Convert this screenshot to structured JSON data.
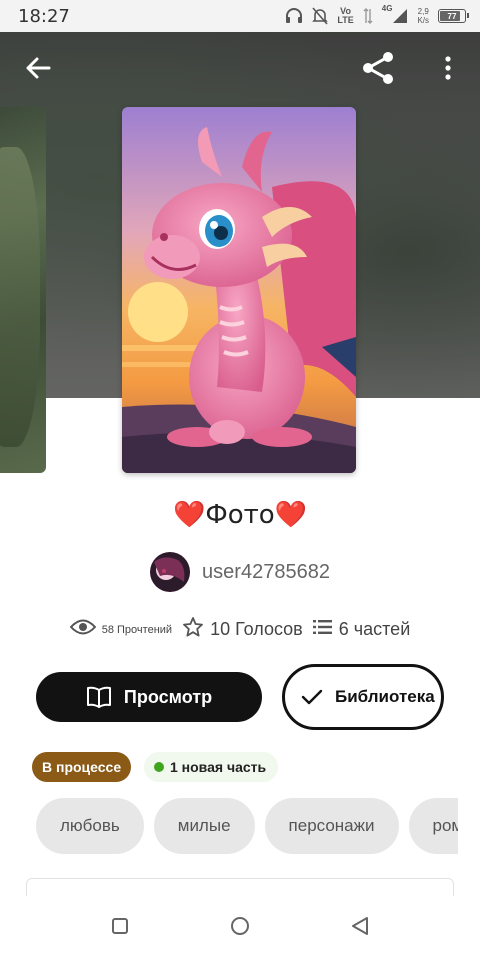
{
  "status_bar": {
    "time": "18:27",
    "signal_label_top": "Vo",
    "signal_label_bottom": "LTE",
    "network_label": "4G",
    "speed_value": "2,9",
    "speed_unit": "K/s",
    "battery_level": "77"
  },
  "header": {
    "back_icon": "arrow-left-icon",
    "share_icon": "share-icon",
    "more_icon": "more-vertical-icon"
  },
  "story": {
    "title_heart_left": "❤️",
    "title_text": "Фото",
    "title_heart_right": "❤️",
    "author_name": "user42785682",
    "reads_label": "58 Прочтений",
    "votes_label": "10 Голосов",
    "parts_label": "6 частей",
    "read_button_label": "Просмотр",
    "library_button_label": "Библиотека",
    "status_chip": "В процессе",
    "new_part_chip": "1 новая часть",
    "tags": [
      "любовь",
      "милые",
      "персонажи",
      "ром"
    ]
  },
  "colors": {
    "status_chip_bg": "#8a5a16",
    "new_part_dot": "#3fa51f",
    "primary_button_bg": "#121212",
    "heart": "#e23b3b"
  }
}
